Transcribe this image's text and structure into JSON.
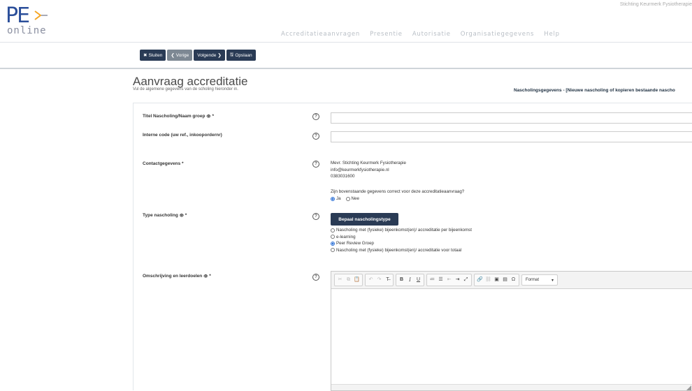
{
  "brand": {
    "pe": "PE",
    "online": "online",
    "org_name": "Stichting Keurmerk Fysiotherapie"
  },
  "nav": [
    "Accreditatieaanvragen",
    "Presentie",
    "Autorisatie",
    "Organisatiegegevens",
    "Help"
  ],
  "toolbar": {
    "close": "Sluiten",
    "prev": "Vorige",
    "next": "Volgende",
    "save": "Opslaan"
  },
  "page": {
    "title": "Aanvraag accreditatie",
    "subtitle": "Vul de algemene gegevens van de scholing hieronder in.",
    "breadcrumb": "Nascholingsgegevens - [Nieuwe nascholing of kopieren bestaande nascho"
  },
  "form": {
    "title_label": "Titel Nascholing/Naam groep",
    "internal_label": "Interne code (uw ref., inkoopordernr)",
    "contact_label": "Contactgegevens",
    "contact_name": "Mevr. Stichting Keurmerk Fysiotherapie",
    "contact_email": "info@keurmerkfysiotherapie.nl",
    "contact_phone": "0383031600",
    "confirm_question": "Zijn bovenstaande gegevens correct voor deze accreditatieaanvraag?",
    "yes": "Ja",
    "no": "Nee",
    "type_label": "Type nascholing",
    "type_button": "Bepaal nascholingstype",
    "type_options": [
      "Nascholing met (fysieke) bijeenkomst(en)/ accreditatie per bijeenkomst",
      "e-learning",
      "Peer Review Groep",
      "Nascholing met (fysieke) bijeenkomst(en)/ accreditatie voor totaal"
    ],
    "type_selected": "Peer Review Groep",
    "desc_label": "Omschrijving en leerdoelen",
    "required_mark": " *",
    "eye": "👁",
    "help": "?",
    "editor_format": "Format"
  },
  "colors": {
    "primary_dark": "#2a3b55",
    "accent": "#2b4f9a"
  }
}
